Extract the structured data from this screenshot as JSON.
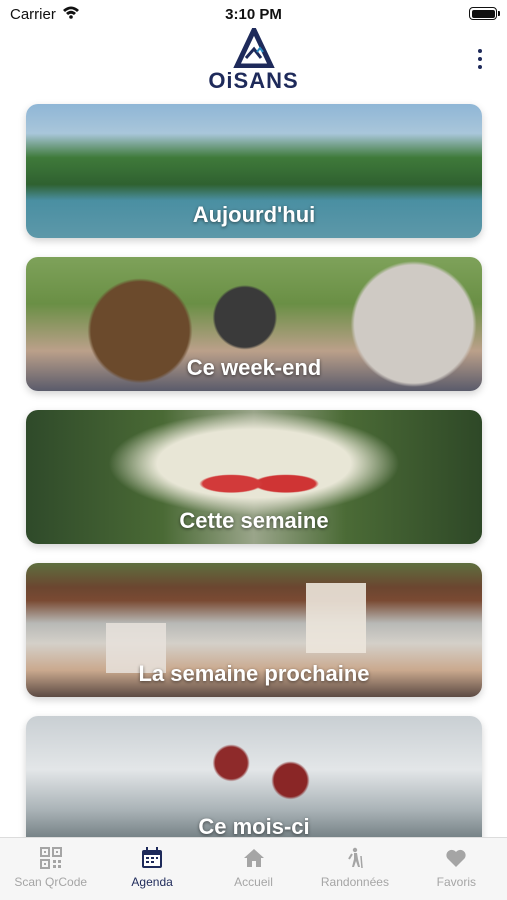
{
  "status_bar": {
    "carrier": "Carrier",
    "time": "3:10 PM"
  },
  "header": {
    "logo_text": "OiSANS"
  },
  "cards": [
    {
      "label": "Aujourd'hui"
    },
    {
      "label": "Ce week-end"
    },
    {
      "label": "Cette semaine"
    },
    {
      "label": "La semaine prochaine"
    },
    {
      "label": "Ce mois-ci"
    }
  ],
  "tabbar": {
    "items": [
      {
        "label": "Scan QrCode",
        "icon": "qrcode-icon",
        "active": false
      },
      {
        "label": "Agenda",
        "icon": "calendar-icon",
        "active": true
      },
      {
        "label": "Accueil",
        "icon": "home-icon",
        "active": false
      },
      {
        "label": "Randonnées",
        "icon": "hiker-icon",
        "active": false
      },
      {
        "label": "Favoris",
        "icon": "heart-icon",
        "active": false
      }
    ]
  },
  "colors": {
    "brand": "#1e2a5a",
    "inactive": "#a5a5a5"
  }
}
